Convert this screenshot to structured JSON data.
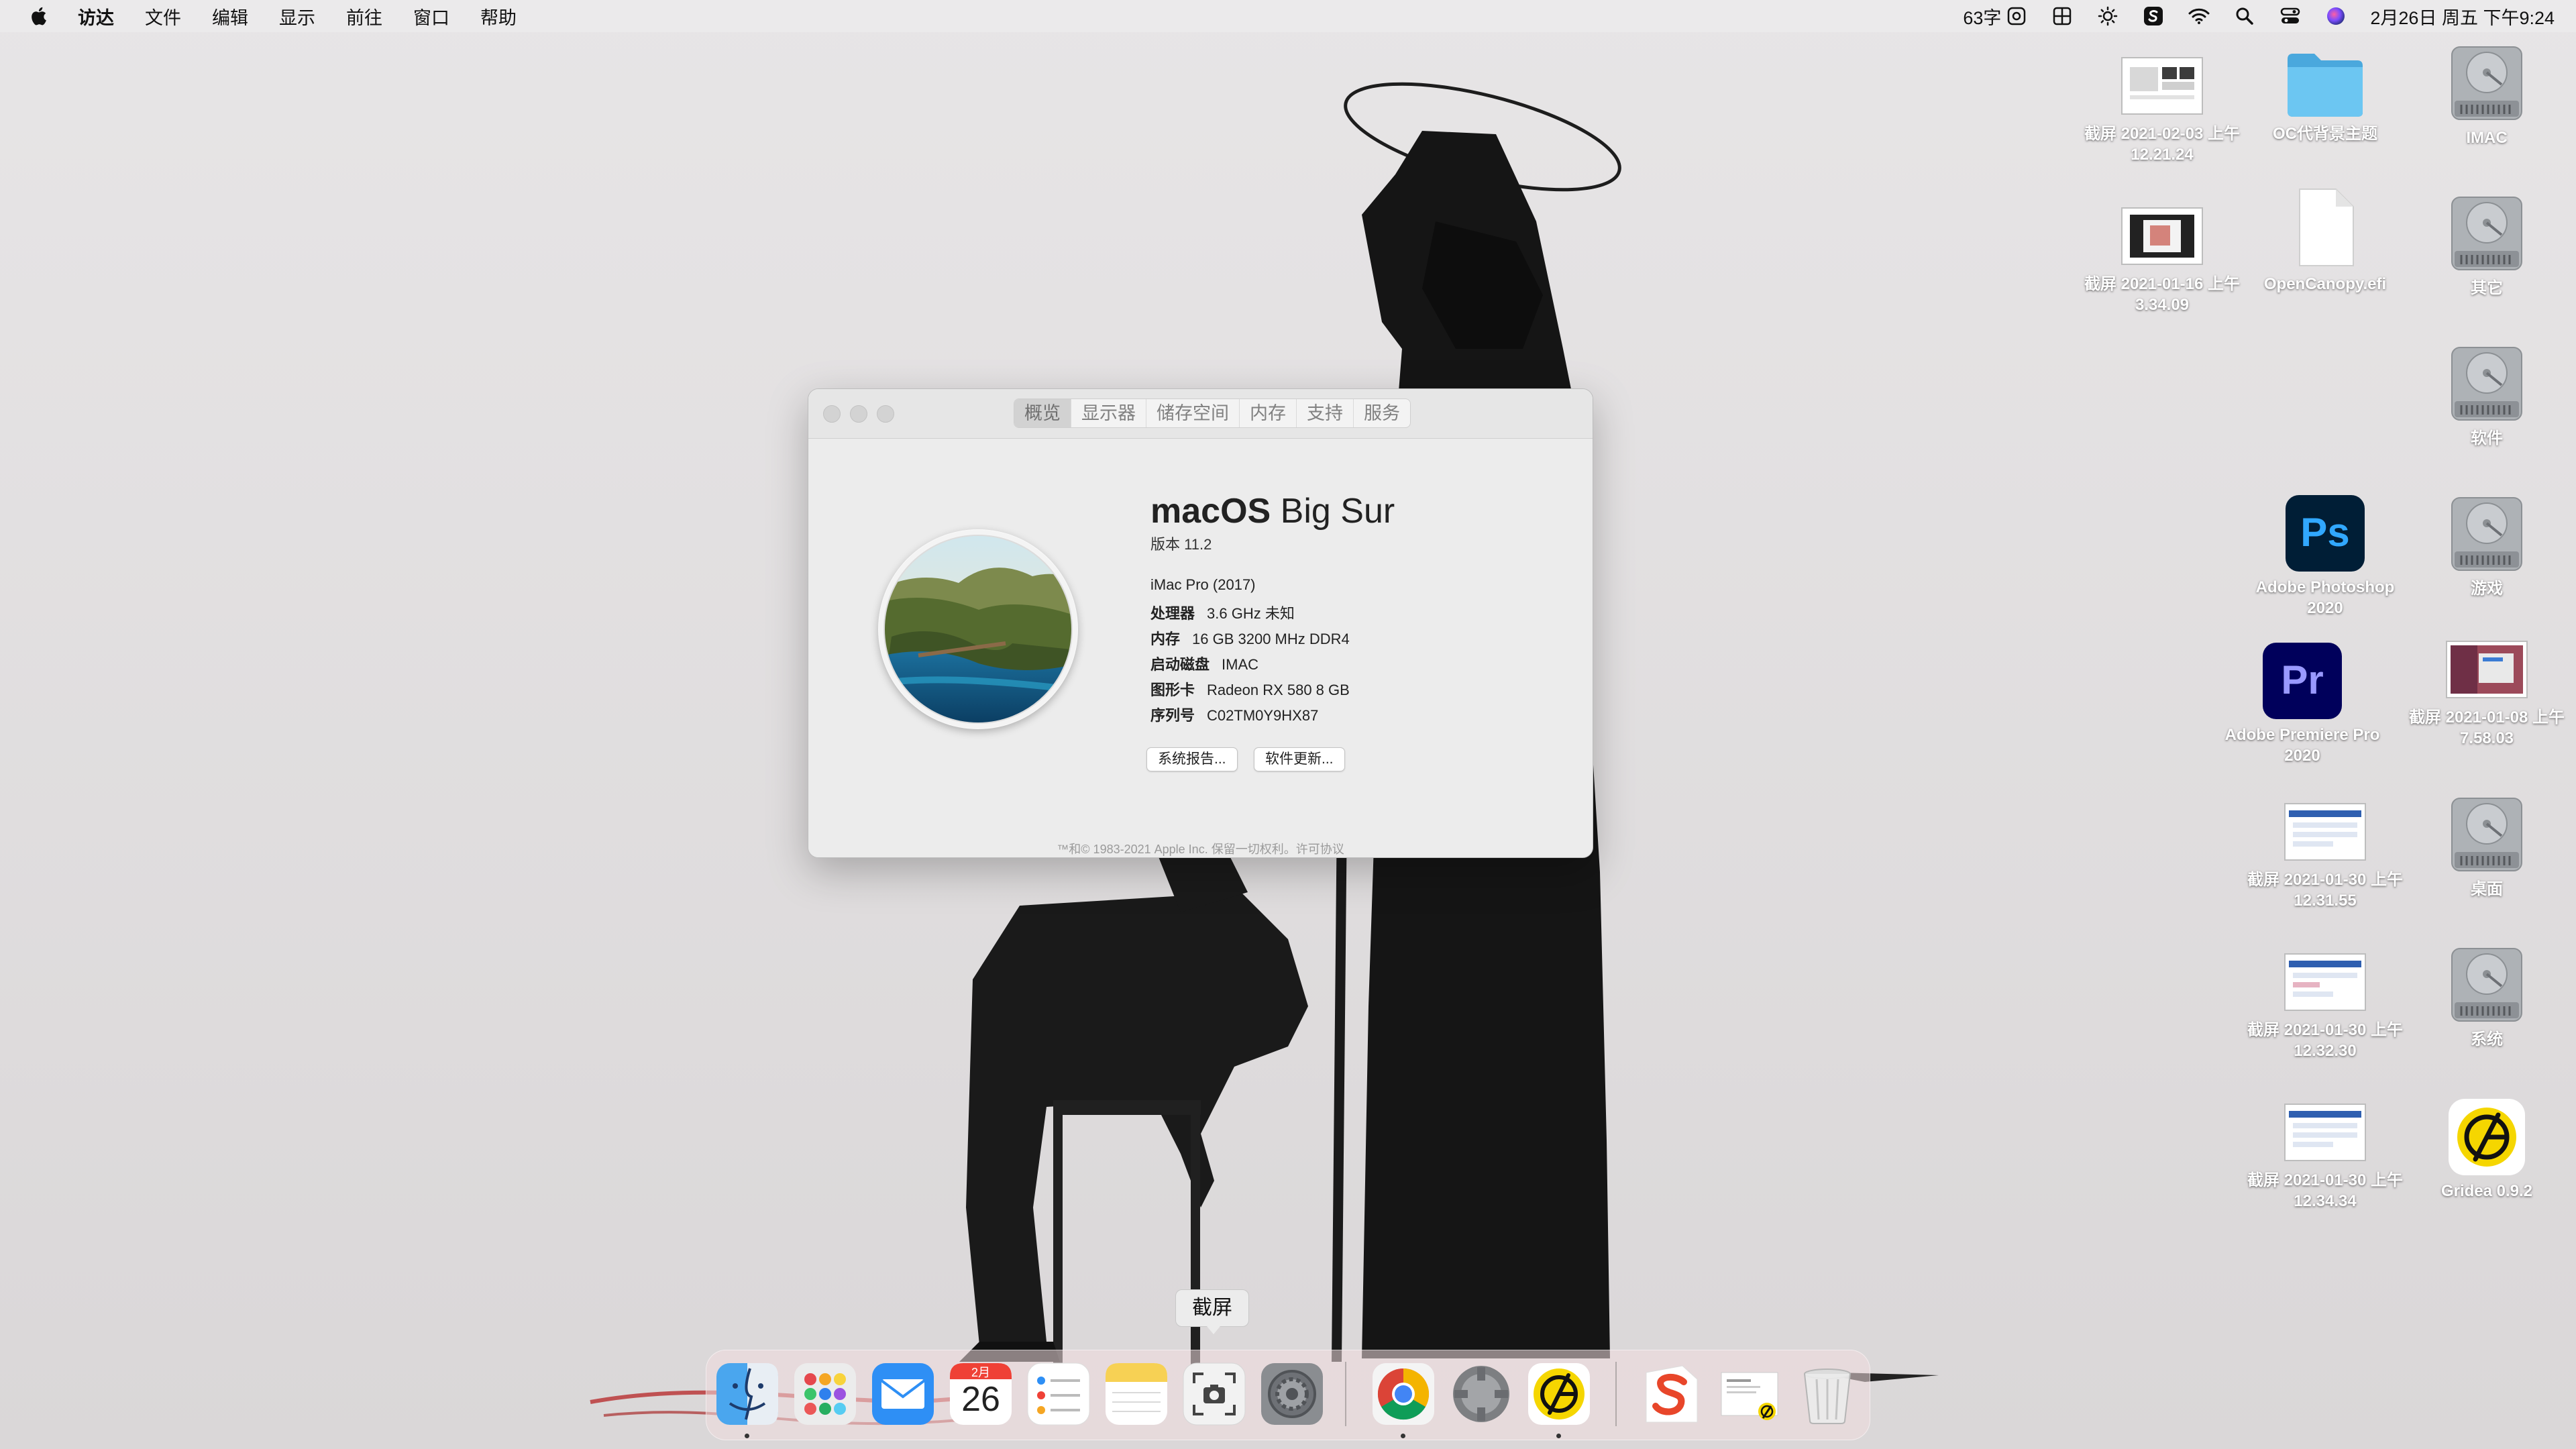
{
  "menubar": {
    "apple": "",
    "items": [
      "访达",
      "文件",
      "编辑",
      "显示",
      "前往",
      "窗口",
      "帮助"
    ],
    "status": {
      "input_count": "63字",
      "datetime": "2月26日 周五 下午9:24"
    }
  },
  "about_window": {
    "tabs": [
      "概览",
      "显示器",
      "储存空间",
      "内存",
      "支持",
      "服务"
    ],
    "selected_tab": "概览",
    "os_name_bold": "macOS",
    "os_name_rest": " Big Sur",
    "version": "版本 11.2",
    "model": "iMac Pro (2017)",
    "specs": [
      {
        "label": "处理器",
        "value": "3.6 GHz 未知"
      },
      {
        "label": "内存",
        "value": "16 GB 3200 MHz DDR4"
      },
      {
        "label": "启动磁盘",
        "value": "IMAC"
      },
      {
        "label": "图形卡",
        "value": "Radeon RX 580 8 GB"
      },
      {
        "label": "序列号",
        "value": "C02TM0Y9HX87"
      }
    ],
    "buttons": {
      "report": "系统报告...",
      "update": "软件更新..."
    },
    "copyright": "™和© 1983-2021 Apple Inc. 保留一切权利。许可协议"
  },
  "desktop_icons": [
    {
      "label": "截屏 2021-02-03 上午12.21.24",
      "kind": "screenshot"
    },
    {
      "label": "OC代背景主题",
      "kind": "folder"
    },
    {
      "label": "IMAC",
      "kind": "drive"
    },
    {
      "label": "截屏 2021-01-16 上午3.34.09",
      "kind": "screenshot"
    },
    {
      "label": "OpenCanopy.efi",
      "kind": "file"
    },
    {
      "label": "其它",
      "kind": "drive"
    },
    {
      "label": "软件",
      "kind": "drive"
    },
    {
      "label": "Adobe Photoshop 2020",
      "kind": "photoshop"
    },
    {
      "label": "游戏",
      "kind": "drive"
    },
    {
      "label": "Adobe Premiere Pro 2020",
      "kind": "premiere"
    },
    {
      "label": "截屏 2021-01-08 上午7.58.03",
      "kind": "screenshot"
    },
    {
      "label": "截屏 2021-01-30 上午12.31.55",
      "kind": "screenshot"
    },
    {
      "label": "桌面",
      "kind": "drive"
    },
    {
      "label": "截屏 2021-01-30 上午12.32.30",
      "kind": "screenshot"
    },
    {
      "label": "系统",
      "kind": "drive"
    },
    {
      "label": "截屏 2021-01-30 上午12.34.34",
      "kind": "screenshot"
    },
    {
      "label": "Gridea 0.9.2",
      "kind": "gridea"
    }
  ],
  "dock": {
    "tooltip": "截屏",
    "calendar_month": "2月",
    "calendar_day": "26",
    "apps": [
      "finder-icon",
      "launchpad-icon",
      "mail-icon",
      "calendar-icon",
      "reminders-icon",
      "notes-icon",
      "screenshot-icon",
      "system-preferences-icon",
      "chrome-icon",
      "app-icon",
      "gridea-icon",
      "sogou-icon",
      "document-icon",
      "trash-icon"
    ]
  },
  "colors": {
    "photoshop": "#001e36",
    "photoshop_text": "#31a8ff",
    "premiere": "#00005b",
    "premiere_text": "#9999ff",
    "gridea": "#f5d600",
    "folder": "#5ec1ee"
  }
}
